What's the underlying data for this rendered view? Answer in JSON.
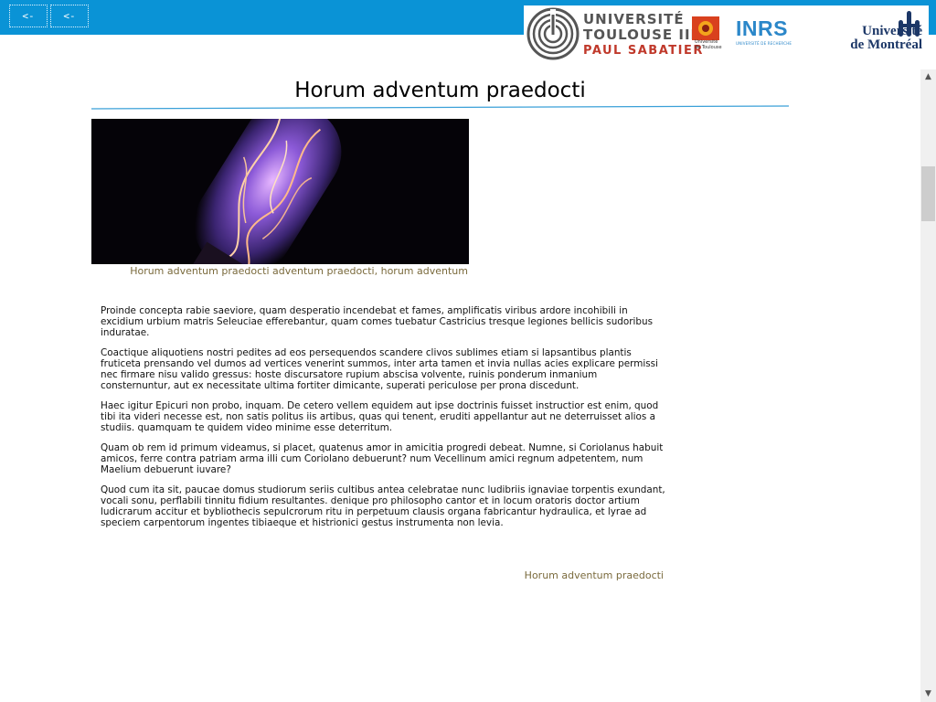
{
  "nav": {
    "back_label": "<-",
    "back2_label": "<-"
  },
  "logos": {
    "toulouse": {
      "line1": "UNIVERSITÉ",
      "line2": "TOULOUSE III",
      "line3": "PAUL SABATIER",
      "small_caption": "Université de Toulouse"
    },
    "inrs": {
      "name": "INRS",
      "subtitle": "UNIVERSITÉ DE RECHERCHE"
    },
    "udem": {
      "line1": "Université",
      "line2": "de Montréal"
    }
  },
  "page": {
    "title": "Horum adventum praedocti",
    "image_caption": "Horum adventum praedocti adventum praedocti, horum adventum",
    "paragraphs": [
      "Proinde concepta rabie saeviore, quam desperatio incendebat et fames, amplificatis viribus ardore incohibili in excidium urbium matris Seleuciae efferebantur, quam comes tuebatur Castricius tresque legiones bellicis sudoribus induratae.",
      "Coactique aliquotiens nostri pedites ad eos persequendos scandere clivos sublimes etiam si lapsantibus plantis fruticeta prensando vel dumos ad vertices venerint summos, inter arta tamen et invia nullas acies explicare permissi nec firmare nisu valido gressus: hoste discursatore rupium abscisa volvente, ruinis ponderum inmanium consternuntur, aut ex necessitate ultima fortiter dimicante, superati periculose per prona discedunt.",
      "Haec igitur Epicuri non probo, inquam. De cetero vellem equidem aut ipse doctrinis fuisset instructior est enim, quod tibi ita videri necesse est, non satis politus iis artibus, quas qui tenent, eruditi appellantur aut ne deterruisset alios a studiis. quamquam te quidem video minime esse deterritum.",
      "Quam ob rem id primum videamus, si placet, quatenus amor in amicitia progredi debeat. Numne, si Coriolanus habuit amicos, ferre contra patriam arma illi cum Coriolano debuerunt? num Vecellinum amici regnum adpetentem, num Maelium debuerunt iuvare?",
      "Quod cum ita sit, paucae domus studiorum seriis cultibus antea celebratae nunc ludibriis ignaviae torpentis exundant, vocali sonu, perflabili tinnitu fidium resultantes. denique pro philosopho cantor et in locum oratoris doctor artium ludicrarum accitur et bybliothecis sepulcrorum ritu in perpetuum clausis organa fabricantur hydraulica, et lyrae ad speciem carpentorum ingentes tibiaeque et histrionici gestus instrumenta non levia."
    ],
    "footer_link": "Horum adventum praedocti"
  },
  "colors": {
    "topbar": "#0a93d6",
    "caption": "#7a6a3c",
    "title_rule": "#3aa0d8"
  },
  "icons": {
    "scroll_up": "triangle-up",
    "scroll_down": "triangle-down"
  }
}
